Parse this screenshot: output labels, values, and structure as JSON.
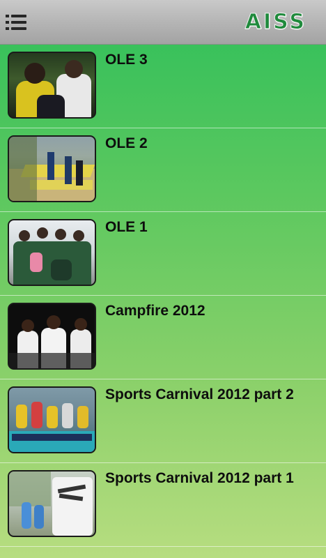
{
  "app": {
    "logo_text": "AISS"
  },
  "header": {
    "menu_icon": "hamburger-menu-icon"
  },
  "albums": [
    {
      "title": "OLE 3",
      "thumbnail": "photo-thumbnail-ole3"
    },
    {
      "title": "OLE 2",
      "thumbnail": "photo-thumbnail-ole2"
    },
    {
      "title": "OLE 1",
      "thumbnail": "photo-thumbnail-ole1"
    },
    {
      "title": "Campfire 2012",
      "thumbnail": "photo-thumbnail-campfire"
    },
    {
      "title": "Sports Carnival 2012 part 2",
      "thumbnail": "photo-thumbnail-carnival2"
    },
    {
      "title": "Sports Carnival 2012 part 1",
      "thumbnail": "photo-thumbnail-carnival1"
    }
  ],
  "colors": {
    "header_bg": "#b5b5b5",
    "logo": "#1f8a3c",
    "list_top": "#2fbf5a",
    "list_bottom": "#b7dd80"
  }
}
